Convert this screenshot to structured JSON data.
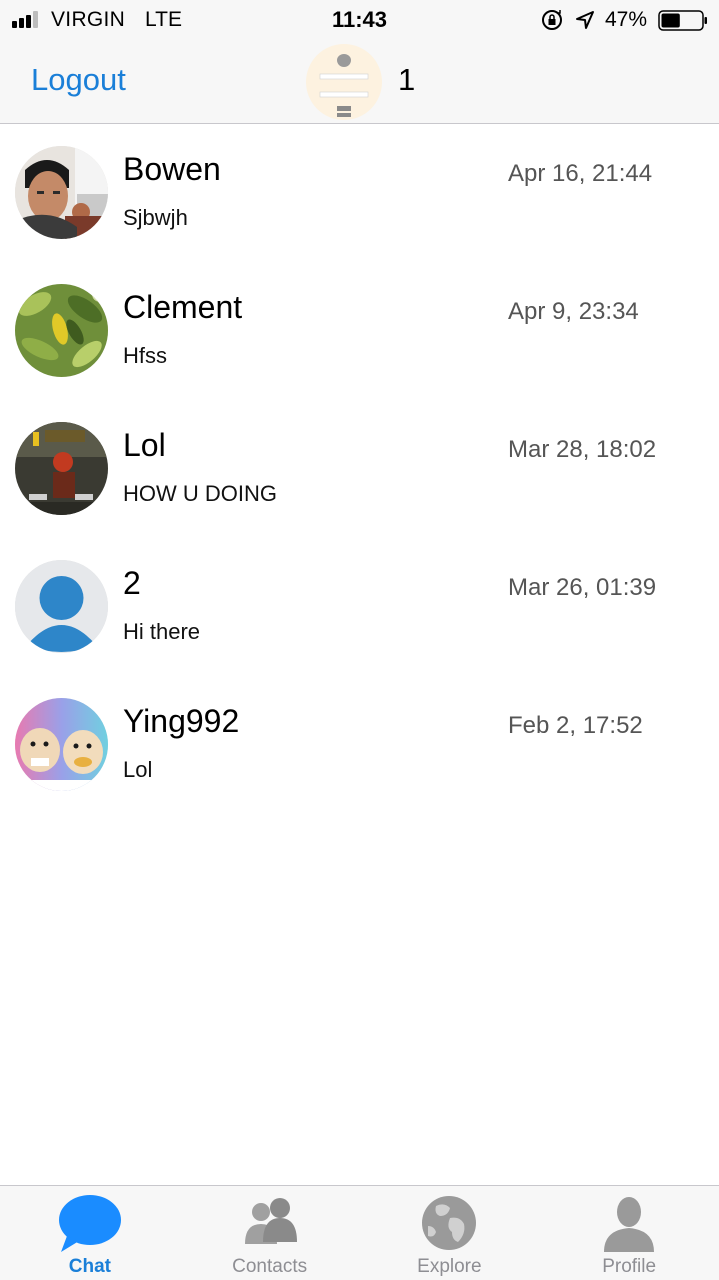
{
  "status_bar": {
    "carrier": "VIRGIN",
    "network": "LTE",
    "time": "11:43",
    "battery": "47%",
    "battery_level": 0.47,
    "signal_bars": 3
  },
  "nav": {
    "logout_label": "Logout",
    "count": "1"
  },
  "chats": [
    {
      "name": "Bowen",
      "message": "Sjbwjh",
      "time": "Apr 16, 21:44",
      "avatar": "photo-person-avatar"
    },
    {
      "name": "Clement",
      "message": "Hfss",
      "time": "Apr 9, 23:34",
      "avatar": "photo-leaves-avatar"
    },
    {
      "name": "Lol",
      "message": "HOW U DOING",
      "time": "Mar 28, 18:02",
      "avatar": "photo-game-avatar"
    },
    {
      "name": "2",
      "message": "Hi there",
      "time": "Mar 26, 01:39",
      "avatar": "default-user-avatar"
    },
    {
      "name": "Ying992",
      "message": "Lol",
      "time": "Feb 2, 17:52",
      "avatar": "photo-hamsters-avatar"
    }
  ],
  "tabs": [
    {
      "label": "Chat",
      "icon": "chat-bubble-icon",
      "active": true
    },
    {
      "label": "Contacts",
      "icon": "contacts-icon",
      "active": false
    },
    {
      "label": "Explore",
      "icon": "globe-icon",
      "active": false
    },
    {
      "label": "Profile",
      "icon": "person-icon",
      "active": false
    }
  ],
  "colors": {
    "accent": "#1a7fd8",
    "tab_inactive": "#8e8e93",
    "chat_bubble": "#1a8cff"
  }
}
